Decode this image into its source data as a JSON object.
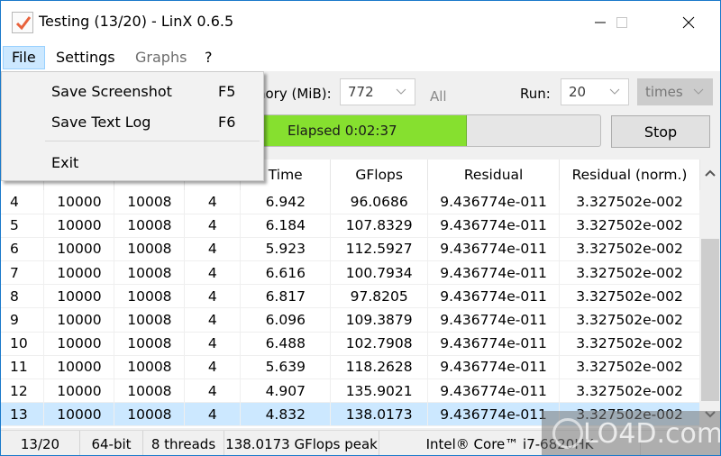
{
  "window": {
    "title": "Testing (13/20) - LinX 0.6.5",
    "app_icon": "checkbox-check-icon",
    "controls": {
      "minimize": "minimize-icon",
      "maximize": "maximize-icon",
      "close": "close-icon"
    }
  },
  "menubar": {
    "items": [
      {
        "label": "File",
        "state": "open"
      },
      {
        "label": "Settings",
        "state": "enabled"
      },
      {
        "label": "Graphs",
        "state": "disabled"
      },
      {
        "label": "?",
        "state": "enabled"
      }
    ]
  },
  "file_menu": {
    "items": [
      {
        "label": "Save Screenshot",
        "shortcut": "F5"
      },
      {
        "label": "Save Text Log",
        "shortcut": "F6"
      },
      {
        "label": "Exit",
        "shortcut": ""
      }
    ]
  },
  "toolbar": {
    "memory_label": "nory (MiB):",
    "memory_value": "772",
    "all_label": "All",
    "run_label": "Run:",
    "run_value": "20",
    "times_value": "times",
    "progress_text": "Elapsed 0:02:37",
    "progress_fraction": 0.65,
    "progress_color": "#86e02f",
    "stop_label": "Stop"
  },
  "table": {
    "columns": [
      "",
      "",
      "",
      "",
      "Time",
      "GFlops",
      "Residual",
      "Residual (norm.)"
    ],
    "rows": [
      [
        "4",
        "10000",
        "10008",
        "4",
        "6.942",
        "96.0686",
        "9.436774e-011",
        "3.327502e-002"
      ],
      [
        "5",
        "10000",
        "10008",
        "4",
        "6.184",
        "107.8329",
        "9.436774e-011",
        "3.327502e-002"
      ],
      [
        "6",
        "10000",
        "10008",
        "4",
        "5.923",
        "112.5927",
        "9.436774e-011",
        "3.327502e-002"
      ],
      [
        "7",
        "10000",
        "10008",
        "4",
        "6.616",
        "100.7934",
        "9.436774e-011",
        "3.327502e-002"
      ],
      [
        "8",
        "10000",
        "10008",
        "4",
        "6.817",
        "97.8205",
        "9.436774e-011",
        "3.327502e-002"
      ],
      [
        "9",
        "10000",
        "10008",
        "4",
        "6.096",
        "109.3879",
        "9.436774e-011",
        "3.327502e-002"
      ],
      [
        "10",
        "10000",
        "10008",
        "4",
        "6.488",
        "102.7908",
        "9.436774e-011",
        "3.327502e-002"
      ],
      [
        "11",
        "10000",
        "10008",
        "4",
        "5.639",
        "118.2628",
        "9.436774e-011",
        "3.327502e-002"
      ],
      [
        "12",
        "10000",
        "10008",
        "4",
        "4.907",
        "135.9021",
        "9.436774e-011",
        "3.327502e-002"
      ],
      [
        "13",
        "10000",
        "10008",
        "4",
        "4.832",
        "138.0173",
        "9.436774e-011",
        "3.327502e-002"
      ]
    ],
    "selected_row": 9,
    "selection_color": "#cce8ff"
  },
  "statusbar": {
    "progress": "13/20",
    "arch": "64-bit",
    "threads": "8 threads",
    "peak": "138.0173 GFlops peak",
    "cpu": "Intel® Core™ i7-6820HK"
  },
  "watermark": {
    "text": "LO4D.com"
  }
}
